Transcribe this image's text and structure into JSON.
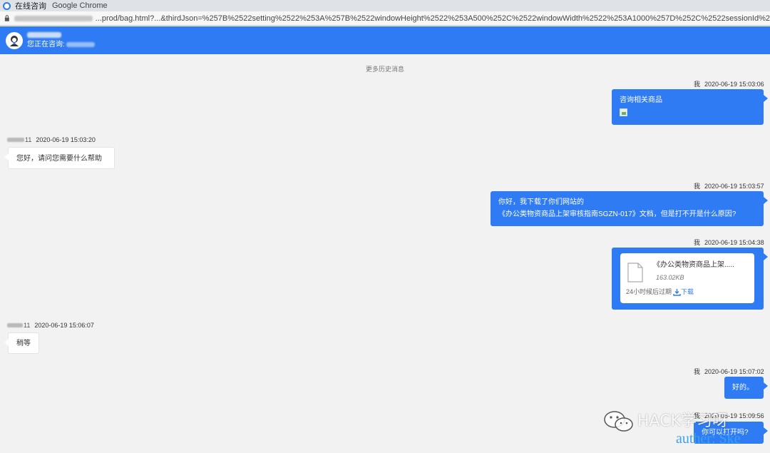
{
  "window": {
    "app_name": "在线咨询",
    "browser_name": "Google Chrome"
  },
  "address_bar": {
    "url_visible": "...prod/bag.html?...&thirdJson=%257B%2522setting%2522%253A%257B%2522windowHeight%2522%253A500%252C%2522windowWidth%2522%253A1000%257D%252C%2522sessionId%2"
  },
  "header": {
    "consulting_label": "您正在咨询:"
  },
  "more_history": "更多历史消息",
  "messages": [
    {
      "side": "right",
      "sender": "我",
      "time": "2020-06-19 15:03:06",
      "text": "咨询相关商品",
      "has_image": true
    },
    {
      "side": "left",
      "sender_suffix": "11",
      "time": "2020-06-19 15:03:20",
      "text": "您好，请问您需要什么帮助"
    },
    {
      "side": "right",
      "sender": "我",
      "time": "2020-06-19 15:03:57",
      "lines": [
        "你好，我下载了你们网站的",
        "《办公类物资商品上架审核指南SGZN-017》文档，但是打不开是什么原因?"
      ]
    },
    {
      "side": "right",
      "sender": "我",
      "time": "2020-06-19 15:04:38",
      "file": {
        "name": "《办公类物资商品上架.....",
        "size": "163.02KB",
        "expire": "24小时候后过期",
        "download": "下载"
      }
    },
    {
      "side": "left",
      "sender_suffix": "11",
      "time": "2020-06-19 15:06:07",
      "text": "稍等"
    },
    {
      "side": "right",
      "sender": "我",
      "time": "2020-06-19 15:07:02",
      "text": "好的。"
    },
    {
      "side": "right",
      "sender": "我",
      "time": "2020-06-19 15:09:56",
      "text": "你可以打开吗?"
    }
  ],
  "watermark": {
    "text": "HACK学习呀",
    "author": "auther: Ske"
  },
  "colors": {
    "accent": "#2f7bf3",
    "background": "#f2f2f2"
  }
}
